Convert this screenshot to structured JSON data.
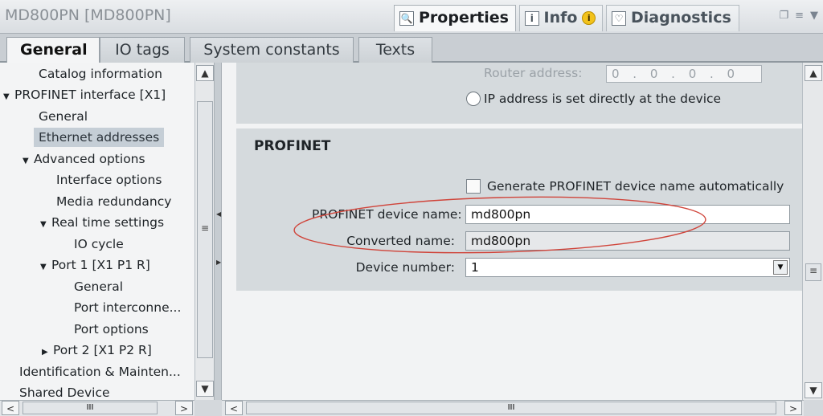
{
  "window": {
    "title": "MD800PN [MD800PN]"
  },
  "inspector_tabs": [
    {
      "label": "Properties",
      "icon": "properties-icon"
    },
    {
      "label": "Info",
      "icon": "info-icon",
      "badge": "i"
    },
    {
      "label": "Diagnostics",
      "icon": "diagnostics-icon"
    }
  ],
  "section_tabs": [
    "General",
    "IO tags",
    "System constants",
    "Texts"
  ],
  "tree": [
    {
      "label": "Catalog information"
    },
    {
      "label": "PROFINET interface [X1]",
      "toggle": "▼"
    },
    {
      "label": "General"
    },
    {
      "label": "Ethernet addresses",
      "selected": true
    },
    {
      "label": "Advanced options",
      "toggle": "▼"
    },
    {
      "label": "Interface options"
    },
    {
      "label": "Media redundancy"
    },
    {
      "label": "Real time settings",
      "toggle": "▼"
    },
    {
      "label": "IO cycle"
    },
    {
      "label": "Port 1 [X1 P1 R]",
      "toggle": "▼"
    },
    {
      "label": "General"
    },
    {
      "label": "Port interconne..."
    },
    {
      "label": "Port options"
    },
    {
      "label": "Port 2 [X1 P2 R]",
      "toggle": "▶"
    },
    {
      "label": "Identification & Mainten..."
    },
    {
      "label": "Shared Device"
    }
  ],
  "ip": {
    "router_label": "Router address:",
    "router_value": "0 . 0 . 0 . 0",
    "radio_label": "IP address is set directly at the device"
  },
  "profinet": {
    "heading": "PROFINET",
    "auto_name_label": "Generate PROFINET device name automatically",
    "device_name_label": "PROFINET device name:",
    "device_name_value": "md800pn",
    "converted_label": "Converted name:",
    "converted_value": "md800pn",
    "device_number_label": "Device number:",
    "device_number_value": "1"
  },
  "annotation": {
    "color": "#d0443a"
  },
  "scroll_glyphs": {
    "up": "▲",
    "down": "▼",
    "left": "<",
    "right": ">",
    "grip": "≡",
    "hgrip": "III"
  }
}
